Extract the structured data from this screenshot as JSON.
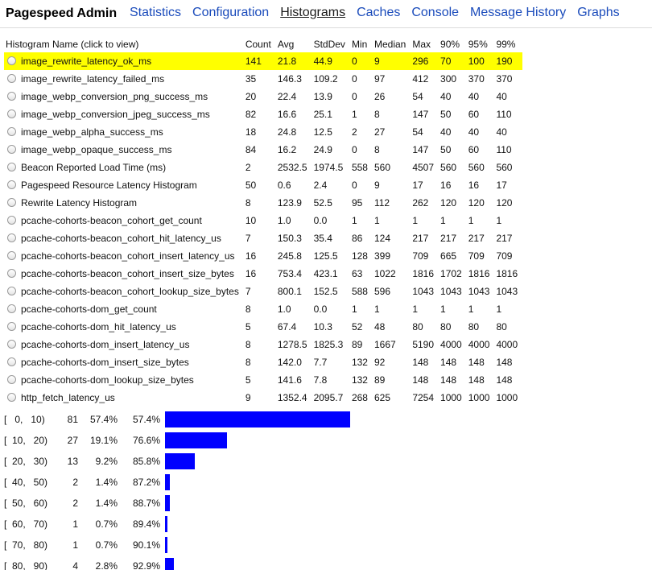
{
  "nav": {
    "brand": "Pagespeed Admin",
    "links": [
      "Statistics",
      "Configuration",
      "Histograms",
      "Caches",
      "Console",
      "Message History",
      "Graphs"
    ],
    "active": "Histograms"
  },
  "table": {
    "headers": [
      "Histogram Name (click to view)",
      "Count",
      "Avg",
      "StdDev",
      "Min",
      "Median",
      "Max",
      "90%",
      "95%",
      "99%"
    ],
    "selected_index": 0,
    "highlight_color": "#ffff00",
    "rows": [
      [
        "image_rewrite_latency_ok_ms",
        "141",
        "21.8",
        "44.9",
        "0",
        "9",
        "296",
        "70",
        "100",
        "190"
      ],
      [
        "image_rewrite_latency_failed_ms",
        "35",
        "146.3",
        "109.2",
        "0",
        "97",
        "412",
        "300",
        "370",
        "370"
      ],
      [
        "image_webp_conversion_png_success_ms",
        "20",
        "22.4",
        "13.9",
        "0",
        "26",
        "54",
        "40",
        "40",
        "40"
      ],
      [
        "image_webp_conversion_jpeg_success_ms",
        "82",
        "16.6",
        "25.1",
        "1",
        "8",
        "147",
        "50",
        "60",
        "110"
      ],
      [
        "image_webp_alpha_success_ms",
        "18",
        "24.8",
        "12.5",
        "2",
        "27",
        "54",
        "40",
        "40",
        "40"
      ],
      [
        "image_webp_opaque_success_ms",
        "84",
        "16.2",
        "24.9",
        "0",
        "8",
        "147",
        "50",
        "60",
        "110"
      ],
      [
        "Beacon Reported Load Time (ms)",
        "2",
        "2532.5",
        "1974.5",
        "558",
        "560",
        "4507",
        "560",
        "560",
        "560"
      ],
      [
        "Pagespeed Resource Latency Histogram",
        "50",
        "0.6",
        "2.4",
        "0",
        "9",
        "17",
        "16",
        "16",
        "17"
      ],
      [
        "Rewrite Latency Histogram",
        "8",
        "123.9",
        "52.5",
        "95",
        "112",
        "262",
        "120",
        "120",
        "120"
      ],
      [
        "pcache-cohorts-beacon_cohort_get_count",
        "10",
        "1.0",
        "0.0",
        "1",
        "1",
        "1",
        "1",
        "1",
        "1"
      ],
      [
        "pcache-cohorts-beacon_cohort_hit_latency_us",
        "7",
        "150.3",
        "35.4",
        "86",
        "124",
        "217",
        "217",
        "217",
        "217"
      ],
      [
        "pcache-cohorts-beacon_cohort_insert_latency_us",
        "16",
        "245.8",
        "125.5",
        "128",
        "399",
        "709",
        "665",
        "709",
        "709"
      ],
      [
        "pcache-cohorts-beacon_cohort_insert_size_bytes",
        "16",
        "753.4",
        "423.1",
        "63",
        "1022",
        "1816",
        "1702",
        "1816",
        "1816"
      ],
      [
        "pcache-cohorts-beacon_cohort_lookup_size_bytes",
        "7",
        "800.1",
        "152.5",
        "588",
        "596",
        "1043",
        "1043",
        "1043",
        "1043"
      ],
      [
        "pcache-cohorts-dom_get_count",
        "8",
        "1.0",
        "0.0",
        "1",
        "1",
        "1",
        "1",
        "1",
        "1"
      ],
      [
        "pcache-cohorts-dom_hit_latency_us",
        "5",
        "67.4",
        "10.3",
        "52",
        "48",
        "80",
        "80",
        "80",
        "80"
      ],
      [
        "pcache-cohorts-dom_insert_latency_us",
        "8",
        "1278.5",
        "1825.3",
        "89",
        "1667",
        "5190",
        "4000",
        "4000",
        "4000"
      ],
      [
        "pcache-cohorts-dom_insert_size_bytes",
        "8",
        "142.0",
        "7.7",
        "132",
        "92",
        "148",
        "148",
        "148",
        "148"
      ],
      [
        "pcache-cohorts-dom_lookup_size_bytes",
        "5",
        "141.6",
        "7.8",
        "132",
        "89",
        "148",
        "148",
        "148",
        "148"
      ],
      [
        "http_fetch_latency_us",
        "9",
        "1352.4",
        "2095.7",
        "268",
        "625",
        "7254",
        "1000",
        "1000",
        "1000"
      ]
    ]
  },
  "distribution": {
    "bar_color": "#0000ff",
    "rows": [
      {
        "bucket": "[   0,   10)",
        "count": "81",
        "pct": "57.4%",
        "cum": "57.4%",
        "value": 81
      },
      {
        "bucket": "[  10,   20)",
        "count": "27",
        "pct": "19.1%",
        "cum": "76.6%",
        "value": 27
      },
      {
        "bucket": "[  20,   30)",
        "count": "13",
        "pct": "9.2%",
        "cum": "85.8%",
        "value": 13
      },
      {
        "bucket": "[  40,   50)",
        "count": "2",
        "pct": "1.4%",
        "cum": "87.2%",
        "value": 2
      },
      {
        "bucket": "[  50,   60)",
        "count": "2",
        "pct": "1.4%",
        "cum": "88.7%",
        "value": 2
      },
      {
        "bucket": "[  60,   70)",
        "count": "1",
        "pct": "0.7%",
        "cum": "89.4%",
        "value": 1
      },
      {
        "bucket": "[  70,   80)",
        "count": "1",
        "pct": "0.7%",
        "cum": "90.1%",
        "value": 1
      },
      {
        "bucket": "[  80,   90)",
        "count": "4",
        "pct": "2.8%",
        "cum": "92.9%",
        "value": 4
      }
    ]
  }
}
